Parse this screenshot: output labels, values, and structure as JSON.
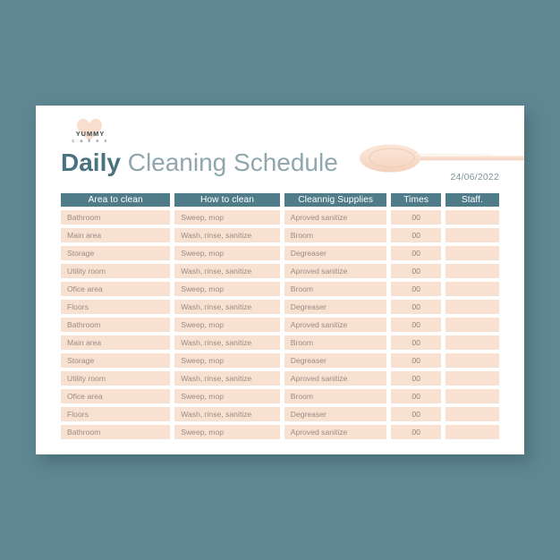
{
  "page": {
    "background_color": "#5f8792",
    "card_color": "#ffffff"
  },
  "logo": {
    "name_top": "YUMMY",
    "name_bottom": "c a k e s",
    "mark": "heart-icon",
    "mark_color": "#f6d8c4"
  },
  "header": {
    "title_bold": "Daily",
    "title_light": "Cleaning Schedule",
    "date": "24/06/2022",
    "decoration": "wooden-spoon-illustration",
    "decoration_color": "#f8ddcb"
  },
  "colors": {
    "accent_teal": "#4f7c88",
    "title_bold": "#4b737f",
    "title_light": "#8fa7ad",
    "row_peach": "#f9e1d1",
    "row_text": "#9a8c85",
    "date_text": "#7d949a"
  },
  "table": {
    "columns": [
      "Area to clean",
      "How to clean",
      "Cleannig Supplies",
      "Times",
      "Staff."
    ],
    "rows": [
      [
        "Bathroom",
        "Sweep, mop",
        "Aproved sanitize",
        "00",
        ""
      ],
      [
        "Main area",
        "Wash, rinse, sanitize",
        "Broom",
        "00",
        ""
      ],
      [
        "Storage",
        "Sweep, mop",
        "Degreaser",
        "00",
        ""
      ],
      [
        "Utility room",
        "Wash, rinse, sanitize",
        "Aproved sanitize",
        "00",
        ""
      ],
      [
        "Ofice area",
        "Sweep, mop",
        "Broom",
        "00",
        ""
      ],
      [
        "Floors",
        "Wash, rinse, sanitize",
        "Degreaser",
        "00",
        ""
      ],
      [
        "Bathroom",
        "Sweep, mop",
        "Aproved sanitize",
        "00",
        ""
      ],
      [
        "Main area",
        "Wash, rinse, sanitize",
        "Broom",
        "00",
        ""
      ],
      [
        "Storage",
        "Sweep, mop",
        "Degreaser",
        "00",
        ""
      ],
      [
        "Utility room",
        "Wash, rinse, sanitize",
        "Aproved sanitize",
        "00",
        ""
      ],
      [
        "Ofice area",
        "Sweep, mop",
        "Broom",
        "00",
        ""
      ],
      [
        "Floors",
        "Wash, rinse, sanitize",
        "Degreaser",
        "00",
        ""
      ],
      [
        "Bathroom",
        "Sweep, mop",
        "Aproved sanitize",
        "00",
        ""
      ]
    ]
  }
}
